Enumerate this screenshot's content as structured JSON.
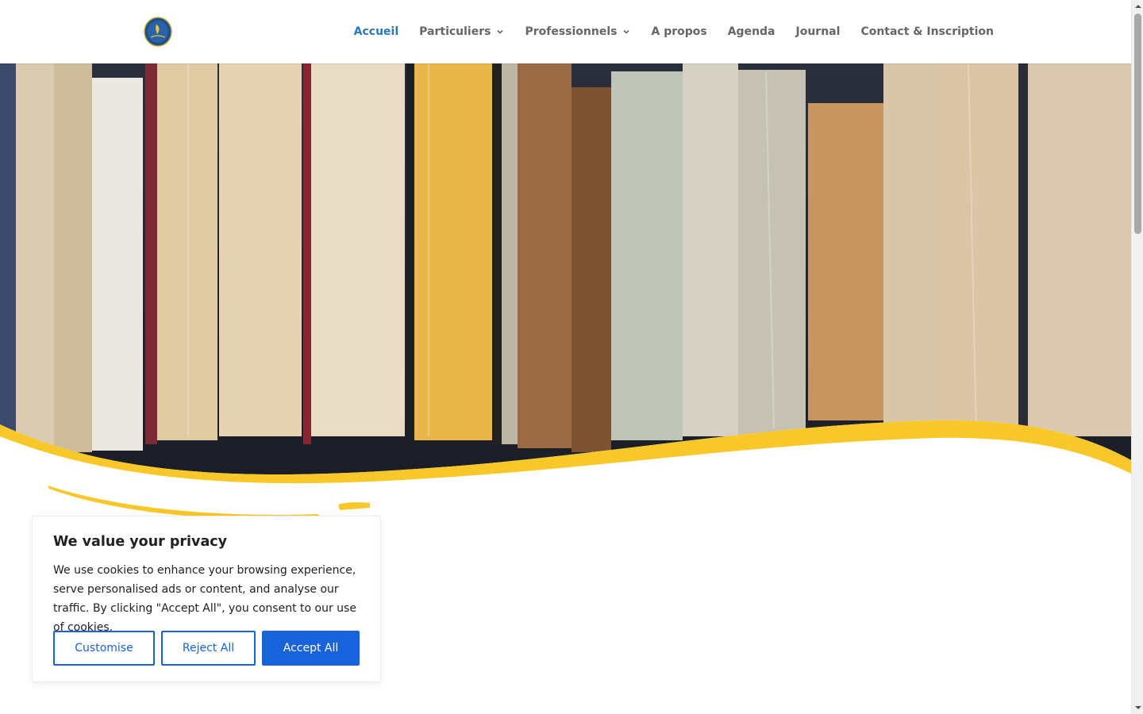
{
  "header": {
    "logo_icon": "school-logo-icon",
    "nav": [
      {
        "label": "Accueil",
        "active": true,
        "has_dropdown": false
      },
      {
        "label": "Particuliers",
        "active": false,
        "has_dropdown": true
      },
      {
        "label": "Professionnels",
        "active": false,
        "has_dropdown": true
      },
      {
        "label": "A propos",
        "active": false,
        "has_dropdown": false
      },
      {
        "label": "Agenda",
        "active": false,
        "has_dropdown": false
      },
      {
        "label": "Journal",
        "active": false,
        "has_dropdown": false
      },
      {
        "label": "Contact & Inscription",
        "active": false,
        "has_dropdown": false
      }
    ]
  },
  "colors": {
    "accent_blue": "#2a78b9",
    "nav_text": "#666666",
    "wave_yellow": "#f8c82a",
    "cookie_button_blue": "#1863dc"
  },
  "hero": {
    "image": "bookshelf-spines-photo"
  },
  "cookie_banner": {
    "title": "We value your privacy",
    "text": "We use cookies to enhance your browsing experience, serve personalised ads or content, and analyse our traffic. By clicking \"Accept All\", you consent to our use of cookies.",
    "customise_label": "Customise",
    "reject_label": "Reject All",
    "accept_label": "Accept All"
  }
}
